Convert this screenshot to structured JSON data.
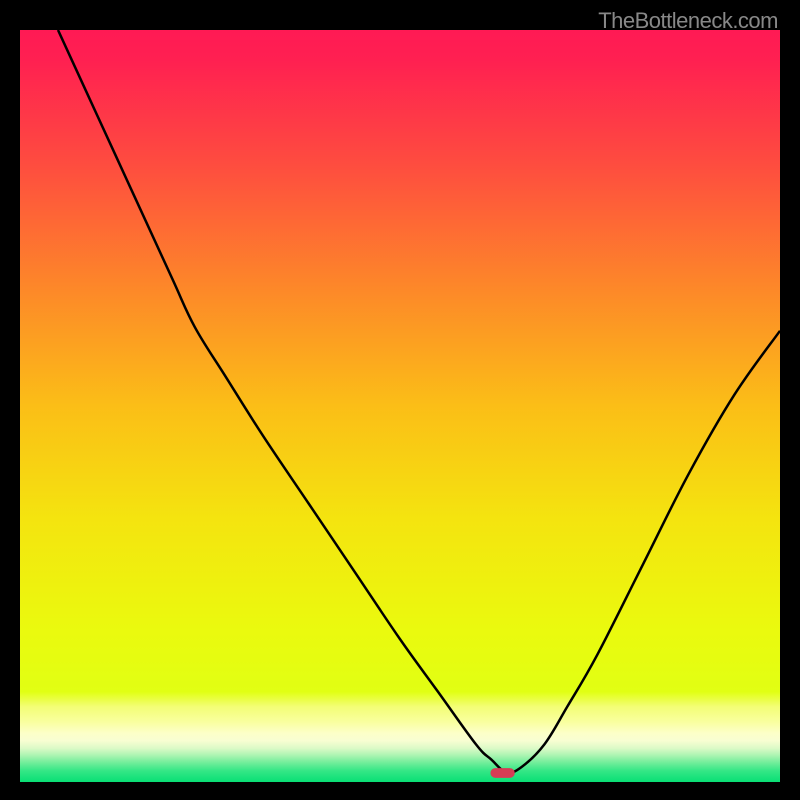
{
  "watermark": "TheBottleneck.com",
  "chart_data": {
    "type": "line",
    "title": "",
    "xlabel": "",
    "ylabel": "",
    "xlim": [
      0,
      100
    ],
    "ylim": [
      0,
      100
    ],
    "background_gradient": {
      "stops": [
        {
          "offset": 0.0,
          "color": "#ff1a54"
        },
        {
          "offset": 0.04,
          "color": "#ff2051"
        },
        {
          "offset": 0.18,
          "color": "#fe4d3f"
        },
        {
          "offset": 0.35,
          "color": "#fd8a28"
        },
        {
          "offset": 0.5,
          "color": "#fbbe17"
        },
        {
          "offset": 0.65,
          "color": "#f4e40f"
        },
        {
          "offset": 0.8,
          "color": "#eafa0e"
        },
        {
          "offset": 0.88,
          "color": "#e1ff13"
        },
        {
          "offset": 0.9,
          "color": "#f3fe76"
        },
        {
          "offset": 0.92,
          "color": "#f9ff9f"
        },
        {
          "offset": 0.935,
          "color": "#fcffc8"
        },
        {
          "offset": 0.945,
          "color": "#f8fed2"
        },
        {
          "offset": 0.955,
          "color": "#dcfac7"
        },
        {
          "offset": 0.965,
          "color": "#a9f4b0"
        },
        {
          "offset": 0.975,
          "color": "#6ded99"
        },
        {
          "offset": 0.985,
          "color": "#35e786"
        },
        {
          "offset": 1.0,
          "color": "#09df75"
        }
      ]
    },
    "series": [
      {
        "name": "curve",
        "x": [
          5,
          10,
          15,
          20,
          23,
          27,
          32,
          38,
          44,
          50,
          55,
          60,
          62,
          64,
          66,
          69,
          72,
          76,
          82,
          88,
          94,
          100
        ],
        "y": [
          100,
          89,
          78,
          67,
          60.5,
          54,
          46,
          37,
          28,
          19,
          12,
          5,
          3,
          1.3,
          2,
          5,
          10,
          17,
          29,
          41,
          51.5,
          60
        ]
      }
    ],
    "marker": {
      "x": 63.5,
      "y": 1.2,
      "w": 3.2,
      "h": 1.3,
      "rx": 0.65
    }
  }
}
